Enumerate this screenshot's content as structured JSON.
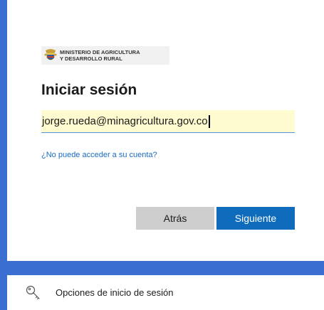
{
  "logo": {
    "line1": "MINISTERIO DE AGRICULTURA",
    "line2": "Y DESARROLLO RURAL",
    "icon": "coat-of-arms-icon"
  },
  "signin": {
    "title": "Iniciar sesión",
    "email_value": "jorge.rueda@minagricultura.gov.co",
    "cant_access_link": "¿No puede acceder a su cuenta?",
    "back_label": "Atrás",
    "next_label": "Siguiente"
  },
  "options": {
    "label": "Opciones de inicio de sesión",
    "icon": "key-icon"
  },
  "colors": {
    "background": "#3a6fd1",
    "primary_button": "#0f6cbd",
    "secondary_button": "#cdcdcd",
    "link": "#1a6bc4",
    "autofill": "#fdfbcf"
  }
}
